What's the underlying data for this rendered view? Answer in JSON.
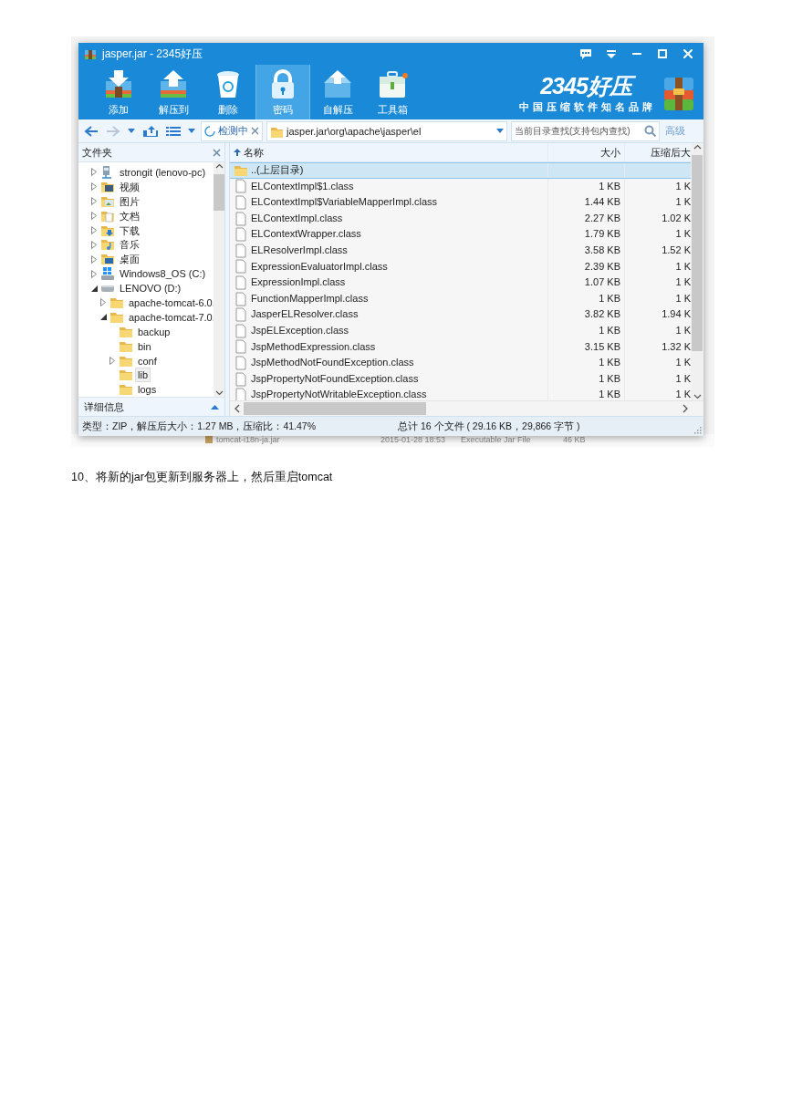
{
  "window": {
    "title": "jasper.jar - 2345好压"
  },
  "toolbar": [
    {
      "label": "添加",
      "kind": "add",
      "selected": false
    },
    {
      "label": "解压到",
      "kind": "extract",
      "selected": false
    },
    {
      "label": "删除",
      "kind": "delete",
      "selected": false
    },
    {
      "label": "密码",
      "kind": "password",
      "selected": true
    },
    {
      "label": "自解压",
      "kind": "selfextract",
      "selected": false
    },
    {
      "label": "工具箱",
      "kind": "toolbox",
      "selected": false
    }
  ],
  "brand": {
    "logo": "2345好压",
    "slogan": "中国压缩软件知名品牌"
  },
  "nav": {
    "scan_tab": "检测中",
    "address": "jasper.jar\\org\\apache\\jasper\\el",
    "search": {
      "placeholder": "当前目录查找(支持包内查找)"
    },
    "advanced": "高级"
  },
  "folders": {
    "title": "文件夹",
    "details": "详细信息",
    "items": [
      {
        "label": "strongit (lenovo-pc)",
        "kind": "network",
        "expanded": false,
        "selected": false
      },
      {
        "label": "视频",
        "kind": "video",
        "expanded": false,
        "selected": false
      },
      {
        "label": "图片",
        "kind": "pictures",
        "expanded": false,
        "selected": false
      },
      {
        "label": "文档",
        "kind": "documents",
        "expanded": false,
        "selected": false
      },
      {
        "label": "下载",
        "kind": "downloads",
        "expanded": false,
        "selected": false
      },
      {
        "label": "音乐",
        "kind": "music",
        "expanded": false,
        "selected": false
      },
      {
        "label": "桌面",
        "kind": "desktop",
        "expanded": false,
        "selected": false
      },
      {
        "label": "Windows8_OS (C:)",
        "kind": "windrive",
        "expanded": false,
        "selected": false
      },
      {
        "label": "LENOVO (D:)",
        "kind": "drive",
        "expanded": true,
        "selected": false,
        "children": [
          {
            "label": "apache-tomcat-6.0.",
            "kind": "folder",
            "expanded": false,
            "selected": false
          },
          {
            "label": "apache-tomcat-7.0.",
            "kind": "folder",
            "expanded": true,
            "selected": false,
            "children": [
              {
                "label": "backup",
                "kind": "folder",
                "selected": false
              },
              {
                "label": "bin",
                "kind": "folder",
                "selected": false
              },
              {
                "label": "conf",
                "kind": "folder",
                "expanded": false,
                "selected": false
              },
              {
                "label": "lib",
                "kind": "folder",
                "selected": true
              },
              {
                "label": "logs",
                "kind": "folder",
                "selected": false
              }
            ]
          }
        ]
      }
    ]
  },
  "table": {
    "columns": [
      "名称",
      "大小",
      "压缩后大"
    ],
    "rows": [
      {
        "name": "..(上层目录)",
        "kind": "parent",
        "selected": true
      },
      {
        "name": "ELContextImpl$1.class",
        "kind": "file",
        "size": "1 KB",
        "packed": "1 K",
        "selected": false
      },
      {
        "name": "ELContextImpl$VariableMapperImpl.class",
        "kind": "file",
        "size": "1.44 KB",
        "packed": "1 K",
        "selected": false
      },
      {
        "name": "ELContextImpl.class",
        "kind": "file",
        "size": "2.27 KB",
        "packed": "1.02 K",
        "selected": false
      },
      {
        "name": "ELContextWrapper.class",
        "kind": "file",
        "size": "1.79 KB",
        "packed": "1 K",
        "selected": false
      },
      {
        "name": "ELResolverImpl.class",
        "kind": "file",
        "size": "3.58 KB",
        "packed": "1.52 K",
        "selected": false
      },
      {
        "name": "ExpressionEvaluatorImpl.class",
        "kind": "file",
        "size": "2.39 KB",
        "packed": "1 K",
        "selected": false
      },
      {
        "name": "ExpressionImpl.class",
        "kind": "file",
        "size": "1.07 KB",
        "packed": "1 K",
        "selected": false
      },
      {
        "name": "FunctionMapperImpl.class",
        "kind": "file",
        "size": "1 KB",
        "packed": "1 K",
        "selected": false
      },
      {
        "name": "JasperELResolver.class",
        "kind": "file",
        "size": "3.82 KB",
        "packed": "1.94 K",
        "selected": false
      },
      {
        "name": "JspELException.class",
        "kind": "file",
        "size": "1 KB",
        "packed": "1 K",
        "selected": false
      },
      {
        "name": "JspMethodExpression.class",
        "kind": "file",
        "size": "3.15 KB",
        "packed": "1.32 K",
        "selected": false
      },
      {
        "name": "JspMethodNotFoundException.class",
        "kind": "file",
        "size": "1 KB",
        "packed": "1 K",
        "selected": false
      },
      {
        "name": "JspPropertyNotFoundException.class",
        "kind": "file",
        "size": "1 KB",
        "packed": "1 K",
        "selected": false
      },
      {
        "name": "JspPropertyNotWritableException.class",
        "kind": "file",
        "size": "1 KB",
        "packed": "1 K",
        "selected": false
      }
    ]
  },
  "status_bar": {
    "left": "类型：ZIP，解压后大小：1.27 MB，压缩比：41.47%",
    "right": "总计 16 个文件 ( 29.16 KB，29,866 字节 )"
  },
  "background_row": {
    "name": "tomcat-i18n-ja.jar",
    "date": "2015-01-28 18:53",
    "type": "Executable Jar File",
    "size": "46 KB"
  },
  "caption": "10、将新的jar包更新到服务器上，然后重启tomcat"
}
